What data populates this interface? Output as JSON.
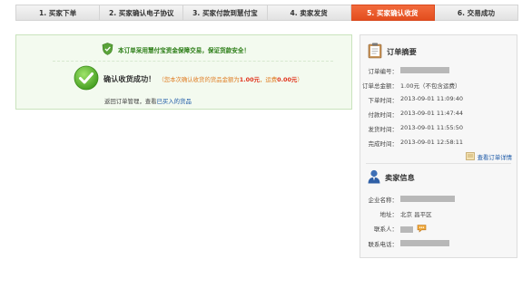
{
  "steps": [
    {
      "label": "1. 买家下单",
      "active": false
    },
    {
      "label": "2. 买家确认电子协议",
      "active": false
    },
    {
      "label": "3. 买家付款到慧付宝",
      "active": false
    },
    {
      "label": "4. 卖家发货",
      "active": false
    },
    {
      "label": "5. 买家确认收货",
      "active": true
    },
    {
      "label": "6. 交易成功",
      "active": false
    }
  ],
  "notice": {
    "guarantee": "本订单采用慧付宝资金保障交易，保证货款安全！",
    "result_title": "确认收货成功！",
    "result_note_prefix": "（您本次确认收货的货品金额为",
    "goods_amount": "1.00元",
    "result_note_mid": "，运费",
    "shipping_amount": "0.00元",
    "result_note_suffix": "）",
    "links_prefix": "返回订单管理，查看",
    "purchased_link": "已买入的货品"
  },
  "order_summary": {
    "title": "订单摘要",
    "rows": [
      {
        "label": "订单编号：",
        "value": ""
      },
      {
        "label": "订单总金额：",
        "value": "1.00元（不包含运费）"
      },
      {
        "label": "下单时间：",
        "value": "2013-09-01 11:09:40"
      },
      {
        "label": "付款时间：",
        "value": "2013-09-01 11:47:44"
      },
      {
        "label": "发货时间：",
        "value": "2013-09-01 11:55:50"
      },
      {
        "label": "完成时间：",
        "value": "2013-09-01 12:58:11"
      }
    ],
    "view_detail": "查看订单详情"
  },
  "seller_info": {
    "title": "卖家信息",
    "rows": [
      {
        "label": "企业名称：",
        "value": ""
      },
      {
        "label": "地址：",
        "value": "北京 昌平区"
      },
      {
        "label": "联系人：",
        "value": ""
      },
      {
        "label": "联系电话：",
        "value": ""
      }
    ]
  },
  "colors": {
    "active_step": "#e8542a",
    "success_bg": "#f3faef",
    "success_text": "#2b7d16",
    "amount_red": "#e1331c",
    "link_blue": "#1a57a6"
  },
  "icons": [
    "shield-check-icon",
    "check-circle-icon",
    "clipboard-icon",
    "person-icon",
    "document-icon",
    "chat-icon"
  ]
}
